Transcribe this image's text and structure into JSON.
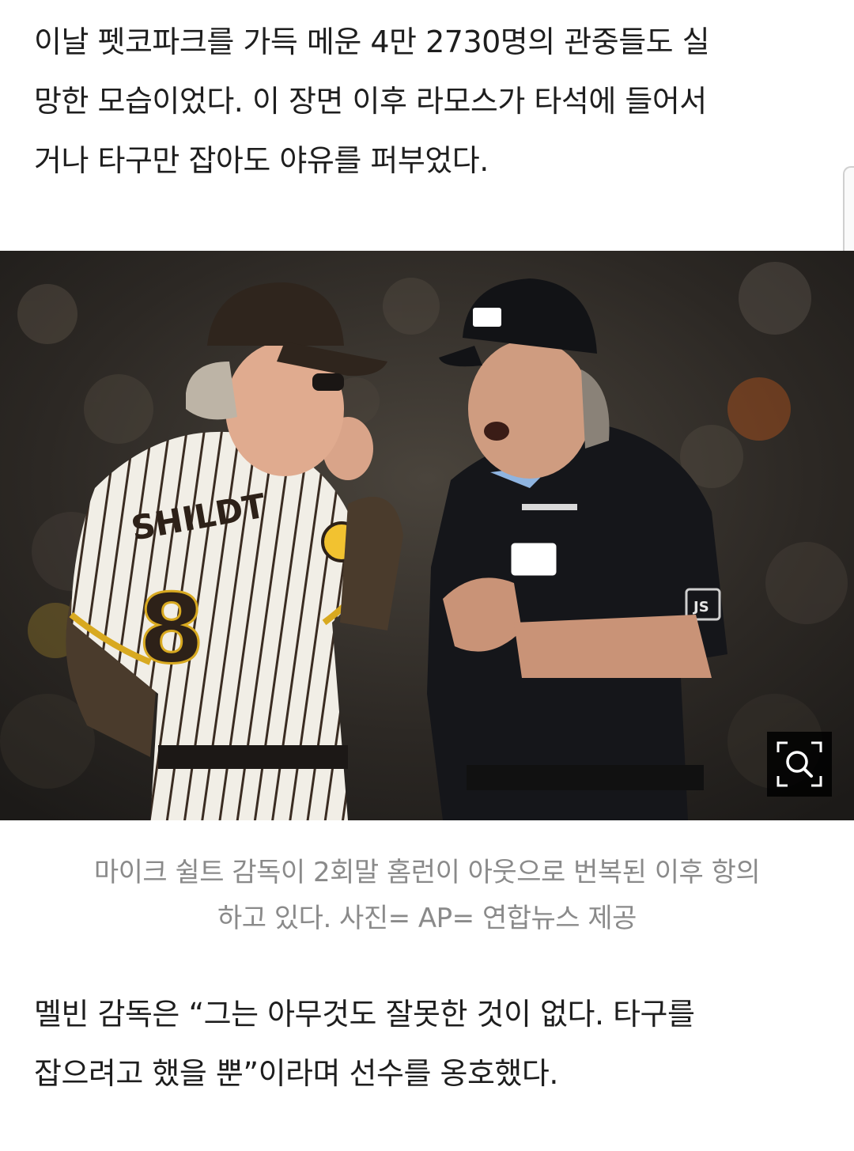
{
  "article": {
    "para_top": [
      "이날 펫코파크를 가득 메운 4만 2730명의 관중들도 실",
      "망한 모습이었다. 이 장면 이후 라모스가 타석에 들어서",
      "거나 타구만 잡아도 야유를 퍼부었다."
    ],
    "photo": {
      "jersey_name": "SHILDT",
      "jersey_number": "8",
      "umpire_patch": "JS",
      "zoom_icon": "zoom-search-icon"
    },
    "caption": [
      "마이크 쉴트 감독이 2회말 홈런이 아웃으로 번복된 이후 항의",
      "하고 있다. 사진= AP= 연합뉴스 제공"
    ],
    "para_bottom": [
      "멜빈 감독은 “그는 아무것도 잘못한 것이 없다. 타구를",
      "잡으려고 했을 뿐”이라며 선수를 옹호했다."
    ]
  }
}
